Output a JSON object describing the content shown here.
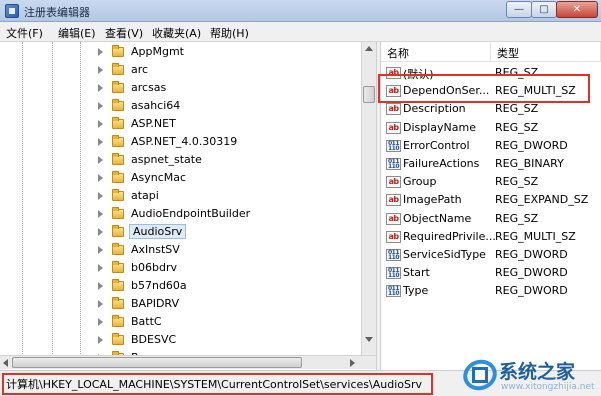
{
  "window": {
    "title": "注册表编辑器",
    "min_label": "—",
    "max_label": "□",
    "close_label": "✕"
  },
  "menu": [
    {
      "label": "文件(F)"
    },
    {
      "label": "编辑(E)"
    },
    {
      "label": "查看(V)"
    },
    {
      "label": "收藏夹(A)"
    },
    {
      "label": "帮助(H)"
    }
  ],
  "tree": {
    "items": [
      {
        "label": "AppMgmt",
        "selected": false
      },
      {
        "label": "arc",
        "selected": false
      },
      {
        "label": "arcsas",
        "selected": false
      },
      {
        "label": "asahci64",
        "selected": false
      },
      {
        "label": "ASP.NET",
        "selected": false
      },
      {
        "label": "ASP.NET_4.0.30319",
        "selected": false
      },
      {
        "label": "aspnet_state",
        "selected": false
      },
      {
        "label": "AsyncMac",
        "selected": false
      },
      {
        "label": "atapi",
        "selected": false
      },
      {
        "label": "AudioEndpointBuilder",
        "selected": false
      },
      {
        "label": "AudioSrv",
        "selected": true
      },
      {
        "label": "AxInstSV",
        "selected": false
      },
      {
        "label": "b06bdrv",
        "selected": false
      },
      {
        "label": "b57nd60a",
        "selected": false
      },
      {
        "label": "BAPIDRV",
        "selected": false
      },
      {
        "label": "BattC",
        "selected": false
      },
      {
        "label": "BDESVC",
        "selected": false
      },
      {
        "label": "Beep",
        "selected": false
      }
    ]
  },
  "values": {
    "header_name": "名称",
    "header_type": "类型",
    "rows": [
      {
        "name": "(默认)",
        "type": "REG_SZ",
        "icon": "ab"
      },
      {
        "name": "DependOnSer...",
        "type": "REG_MULTI_SZ",
        "icon": "ab"
      },
      {
        "name": "Description",
        "type": "REG_SZ",
        "icon": "ab"
      },
      {
        "name": "DisplayName",
        "type": "REG_SZ",
        "icon": "ab"
      },
      {
        "name": "ErrorControl",
        "type": "REG_DWORD",
        "icon": "dword"
      },
      {
        "name": "FailureActions",
        "type": "REG_BINARY",
        "icon": "dword"
      },
      {
        "name": "Group",
        "type": "REG_SZ",
        "icon": "ab"
      },
      {
        "name": "ImagePath",
        "type": "REG_EXPAND_SZ",
        "icon": "ab"
      },
      {
        "name": "ObjectName",
        "type": "REG_SZ",
        "icon": "ab"
      },
      {
        "name": "RequiredPrivile...",
        "type": "REG_MULTI_SZ",
        "icon": "ab"
      },
      {
        "name": "ServiceSidType",
        "type": "REG_DWORD",
        "icon": "dword"
      },
      {
        "name": "Start",
        "type": "REG_DWORD",
        "icon": "dword"
      },
      {
        "name": "Type",
        "type": "REG_DWORD",
        "icon": "dword"
      }
    ]
  },
  "status": {
    "path": "计算机\\HKEY_LOCAL_MACHINE\\SYSTEM\\CurrentControlSet\\services\\AudioSrv"
  },
  "watermark": {
    "text": "系统之家",
    "url": "www.xitongzhijia.net"
  },
  "colors": {
    "highlight": "#d9332a",
    "selection": "#dfeaf8"
  }
}
